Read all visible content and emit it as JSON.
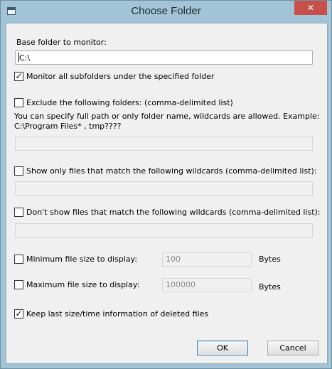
{
  "window": {
    "title": "Choose Folder",
    "close_glyph": "✕"
  },
  "base": {
    "label": "Base folder to monitor:",
    "value": "C:\\"
  },
  "monitor_subfolders": {
    "label": "Monitor all subfolders under the specified folder",
    "checked": true
  },
  "exclude": {
    "label": "Exclude the following folders: (comma-delimited list)",
    "checked": false,
    "hint1": "You can specify full path or only folder name, wildcards are allowed. Example:",
    "hint2": "C:\\Program Files* , tmp????",
    "value": ""
  },
  "show_only": {
    "label": "Show only files that match the following wildcards (comma-delimited list):",
    "checked": false,
    "value": ""
  },
  "dont_show": {
    "label": "Don't show files that match the following wildcards (comma-delimited list):",
    "checked": false,
    "value": ""
  },
  "min_size": {
    "label": "Minimum file size to display:",
    "checked": false,
    "value": "100",
    "unit": "Bytes"
  },
  "max_size": {
    "label": "Maximum file size to display:",
    "checked": false,
    "value": "100000",
    "unit": "Bytes"
  },
  "keep_last": {
    "label": "Keep last size/time information of deleted files",
    "checked": true
  },
  "buttons": {
    "ok": "OK",
    "cancel": "Cancel"
  },
  "check_glyph": "✓"
}
